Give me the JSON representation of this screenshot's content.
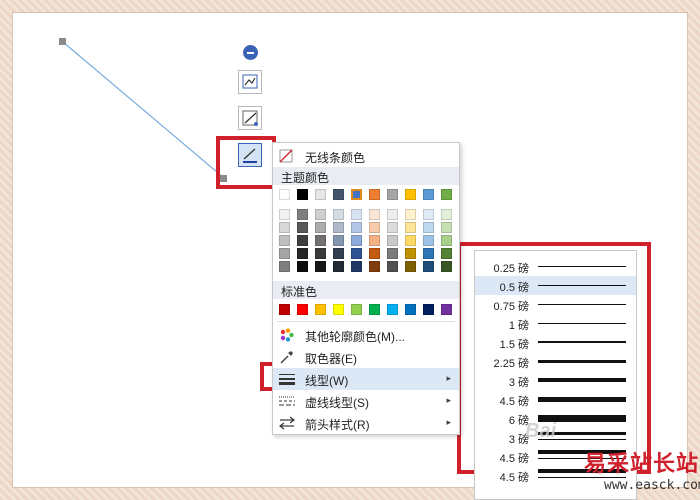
{
  "menu": {
    "no_line_color": "无线条颜色",
    "theme_colors_header": "主题颜色",
    "standard_colors_header": "标准色",
    "more_colors": "其他轮廓颜色(M)...",
    "eyedropper": "取色器(E)",
    "line_type": "线型(W)",
    "dash_type": "虚线线型(S)",
    "arrow_style": "箭头样式(R)",
    "theme_row": [
      "#ffffff",
      "#000000",
      "#e7e6e6",
      "#44546a",
      "#4472c4",
      "#ed7d31",
      "#a5a5a5",
      "#ffc000",
      "#5b9bd5",
      "#70ad47"
    ],
    "theme_tints": [
      [
        "#f2f2f2",
        "#7f7f7f",
        "#d0cece",
        "#d6dce4",
        "#d9e2f3",
        "#fbe5d5",
        "#ededed",
        "#fff2cc",
        "#deebf6",
        "#e2efd9"
      ],
      [
        "#d8d8d8",
        "#595959",
        "#aeabab",
        "#adb9ca",
        "#b4c6e7",
        "#f7cbac",
        "#dbdbdb",
        "#fee599",
        "#bdd7ee",
        "#c5e0b3"
      ],
      [
        "#bfbfbf",
        "#3f3f3f",
        "#757070",
        "#8496b0",
        "#8eaadb",
        "#f4b183",
        "#c9c9c9",
        "#ffd965",
        "#9cc3e5",
        "#a8d08d"
      ],
      [
        "#a5a5a5",
        "#262626",
        "#3a3838",
        "#323f4f",
        "#2f5496",
        "#c55a11",
        "#7b7b7b",
        "#bf9000",
        "#2e75b5",
        "#538135"
      ],
      [
        "#7f7f7f",
        "#0c0c0c",
        "#171616",
        "#222a35",
        "#1f3864",
        "#833c0b",
        "#525252",
        "#7f6000",
        "#1e4e79",
        "#375623"
      ]
    ],
    "standard_row": [
      "#c00000",
      "#ff0000",
      "#ffc000",
      "#ffff00",
      "#92d050",
      "#00b050",
      "#00b0f0",
      "#0070c0",
      "#002060",
      "#7030a0"
    ]
  },
  "line_weights": [
    {
      "label": "0.25 磅",
      "weight": 0.25
    },
    {
      "label": "0.5 磅",
      "weight": 0.5
    },
    {
      "label": "0.75 磅",
      "weight": 0.75
    },
    {
      "label": "1 磅",
      "weight": 1
    },
    {
      "label": "1.5 磅",
      "weight": 1.5
    },
    {
      "label": "2.25 磅",
      "weight": 2.25
    },
    {
      "label": "3 磅",
      "weight": 3
    },
    {
      "label": "4.5 磅",
      "weight": 4.5
    },
    {
      "label": "6 磅",
      "weight": 6
    },
    {
      "label": "3 磅",
      "weight": 3
    },
    {
      "label": "4.5 磅",
      "weight": 4.5
    },
    {
      "label": "4.5 磅",
      "weight": 4.5
    }
  ],
  "selected_weight_label": "0.5 磅",
  "watermark": {
    "title": "易采站长站",
    "url": "www.easck.com"
  },
  "colors": {
    "highlight": "#dde8f7",
    "red_box": "#d0202b",
    "line": "#7aaee0"
  }
}
